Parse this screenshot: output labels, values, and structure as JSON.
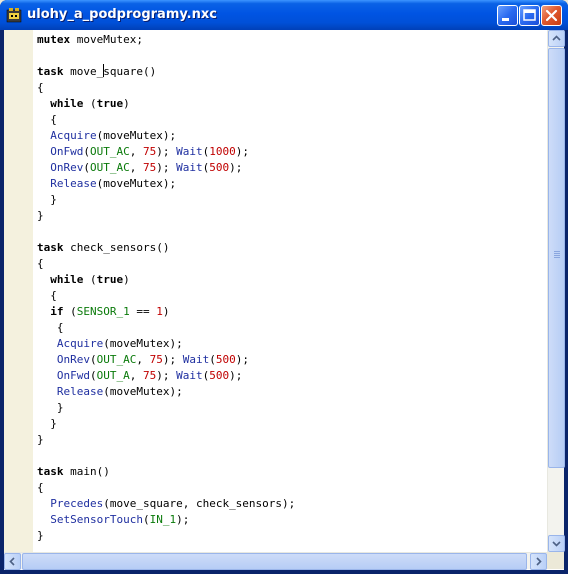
{
  "window": {
    "title": "ulohy_a_podprogramy.nxc",
    "colors": {
      "titlebar": "#0054e3",
      "close_button": "#e05a30"
    }
  },
  "editor": {
    "caret_line": 2,
    "lines": [
      [
        {
          "t": "mutex",
          "c": "kw"
        },
        {
          "t": " moveMutex;",
          "c": ""
        }
      ],
      [],
      [
        {
          "t": "task",
          "c": "kw"
        },
        {
          "t": " move_",
          "c": ""
        },
        {
          "t": "square()",
          "c": ""
        }
      ],
      [
        {
          "t": "{",
          "c": ""
        }
      ],
      [
        {
          "t": "  ",
          "c": ""
        },
        {
          "t": "while",
          "c": "kw"
        },
        {
          "t": " (",
          "c": ""
        },
        {
          "t": "true",
          "c": "kw"
        },
        {
          "t": ")",
          "c": ""
        }
      ],
      [
        {
          "t": "  {",
          "c": ""
        }
      ],
      [
        {
          "t": "  ",
          "c": ""
        },
        {
          "t": "Acquire",
          "c": "fn"
        },
        {
          "t": "(moveMutex);",
          "c": ""
        }
      ],
      [
        {
          "t": "  ",
          "c": ""
        },
        {
          "t": "OnFwd",
          "c": "fn"
        },
        {
          "t": "(",
          "c": ""
        },
        {
          "t": "OUT_AC",
          "c": "const"
        },
        {
          "t": ", ",
          "c": ""
        },
        {
          "t": "75",
          "c": "num"
        },
        {
          "t": "); ",
          "c": ""
        },
        {
          "t": "Wait",
          "c": "fn"
        },
        {
          "t": "(",
          "c": ""
        },
        {
          "t": "1000",
          "c": "num"
        },
        {
          "t": ");",
          "c": ""
        }
      ],
      [
        {
          "t": "  ",
          "c": ""
        },
        {
          "t": "OnRev",
          "c": "fn"
        },
        {
          "t": "(",
          "c": ""
        },
        {
          "t": "OUT_AC",
          "c": "const"
        },
        {
          "t": ", ",
          "c": ""
        },
        {
          "t": "75",
          "c": "num"
        },
        {
          "t": "); ",
          "c": ""
        },
        {
          "t": "Wait",
          "c": "fn"
        },
        {
          "t": "(",
          "c": ""
        },
        {
          "t": "500",
          "c": "num"
        },
        {
          "t": ");",
          "c": ""
        }
      ],
      [
        {
          "t": "  ",
          "c": ""
        },
        {
          "t": "Release",
          "c": "fn"
        },
        {
          "t": "(moveMutex);",
          "c": ""
        }
      ],
      [
        {
          "t": "  }",
          "c": ""
        }
      ],
      [
        {
          "t": "}",
          "c": ""
        }
      ],
      [],
      [
        {
          "t": "task",
          "c": "kw"
        },
        {
          "t": " check_sensors()",
          "c": ""
        }
      ],
      [
        {
          "t": "{",
          "c": ""
        }
      ],
      [
        {
          "t": "  ",
          "c": ""
        },
        {
          "t": "while",
          "c": "kw"
        },
        {
          "t": " (",
          "c": ""
        },
        {
          "t": "true",
          "c": "kw"
        },
        {
          "t": ")",
          "c": ""
        }
      ],
      [
        {
          "t": "  {",
          "c": ""
        }
      ],
      [
        {
          "t": "  ",
          "c": ""
        },
        {
          "t": "if",
          "c": "kw"
        },
        {
          "t": " (",
          "c": ""
        },
        {
          "t": "SENSOR_1",
          "c": "const"
        },
        {
          "t": " == ",
          "c": ""
        },
        {
          "t": "1",
          "c": "num"
        },
        {
          "t": ")",
          "c": ""
        }
      ],
      [
        {
          "t": "   {",
          "c": ""
        }
      ],
      [
        {
          "t": "   ",
          "c": ""
        },
        {
          "t": "Acquire",
          "c": "fn"
        },
        {
          "t": "(moveMutex);",
          "c": ""
        }
      ],
      [
        {
          "t": "   ",
          "c": ""
        },
        {
          "t": "OnRev",
          "c": "fn"
        },
        {
          "t": "(",
          "c": ""
        },
        {
          "t": "OUT_AC",
          "c": "const"
        },
        {
          "t": ", ",
          "c": ""
        },
        {
          "t": "75",
          "c": "num"
        },
        {
          "t": "); ",
          "c": ""
        },
        {
          "t": "Wait",
          "c": "fn"
        },
        {
          "t": "(",
          "c": ""
        },
        {
          "t": "500",
          "c": "num"
        },
        {
          "t": ");",
          "c": ""
        }
      ],
      [
        {
          "t": "   ",
          "c": ""
        },
        {
          "t": "OnFwd",
          "c": "fn"
        },
        {
          "t": "(",
          "c": ""
        },
        {
          "t": "OUT_A",
          "c": "const"
        },
        {
          "t": ", ",
          "c": ""
        },
        {
          "t": "75",
          "c": "num"
        },
        {
          "t": "); ",
          "c": ""
        },
        {
          "t": "Wait",
          "c": "fn"
        },
        {
          "t": "(",
          "c": ""
        },
        {
          "t": "500",
          "c": "num"
        },
        {
          "t": ");",
          "c": ""
        }
      ],
      [
        {
          "t": "   ",
          "c": ""
        },
        {
          "t": "Release",
          "c": "fn"
        },
        {
          "t": "(moveMutex);",
          "c": ""
        }
      ],
      [
        {
          "t": "   }",
          "c": ""
        }
      ],
      [
        {
          "t": "  }",
          "c": ""
        }
      ],
      [
        {
          "t": "}",
          "c": ""
        }
      ],
      [],
      [
        {
          "t": "task",
          "c": "kw"
        },
        {
          "t": " main()",
          "c": ""
        }
      ],
      [
        {
          "t": "{",
          "c": ""
        }
      ],
      [
        {
          "t": "  ",
          "c": ""
        },
        {
          "t": "Precedes",
          "c": "fn"
        },
        {
          "t": "(move_square, check_sensors);",
          "c": ""
        }
      ],
      [
        {
          "t": "  ",
          "c": ""
        },
        {
          "t": "SetSensorTouch",
          "c": "fn"
        },
        {
          "t": "(",
          "c": ""
        },
        {
          "t": "IN_1",
          "c": "const"
        },
        {
          "t": ");",
          "c": ""
        }
      ],
      [
        {
          "t": "}",
          "c": ""
        }
      ]
    ]
  },
  "icons": {
    "app": "bricx-app-icon",
    "minimize": "minimize-icon",
    "maximize": "maximize-icon",
    "close": "close-icon",
    "scroll_up": "arrow-up-icon",
    "scroll_down": "arrow-down-icon",
    "scroll_left": "arrow-left-icon",
    "scroll_right": "arrow-right-icon"
  }
}
